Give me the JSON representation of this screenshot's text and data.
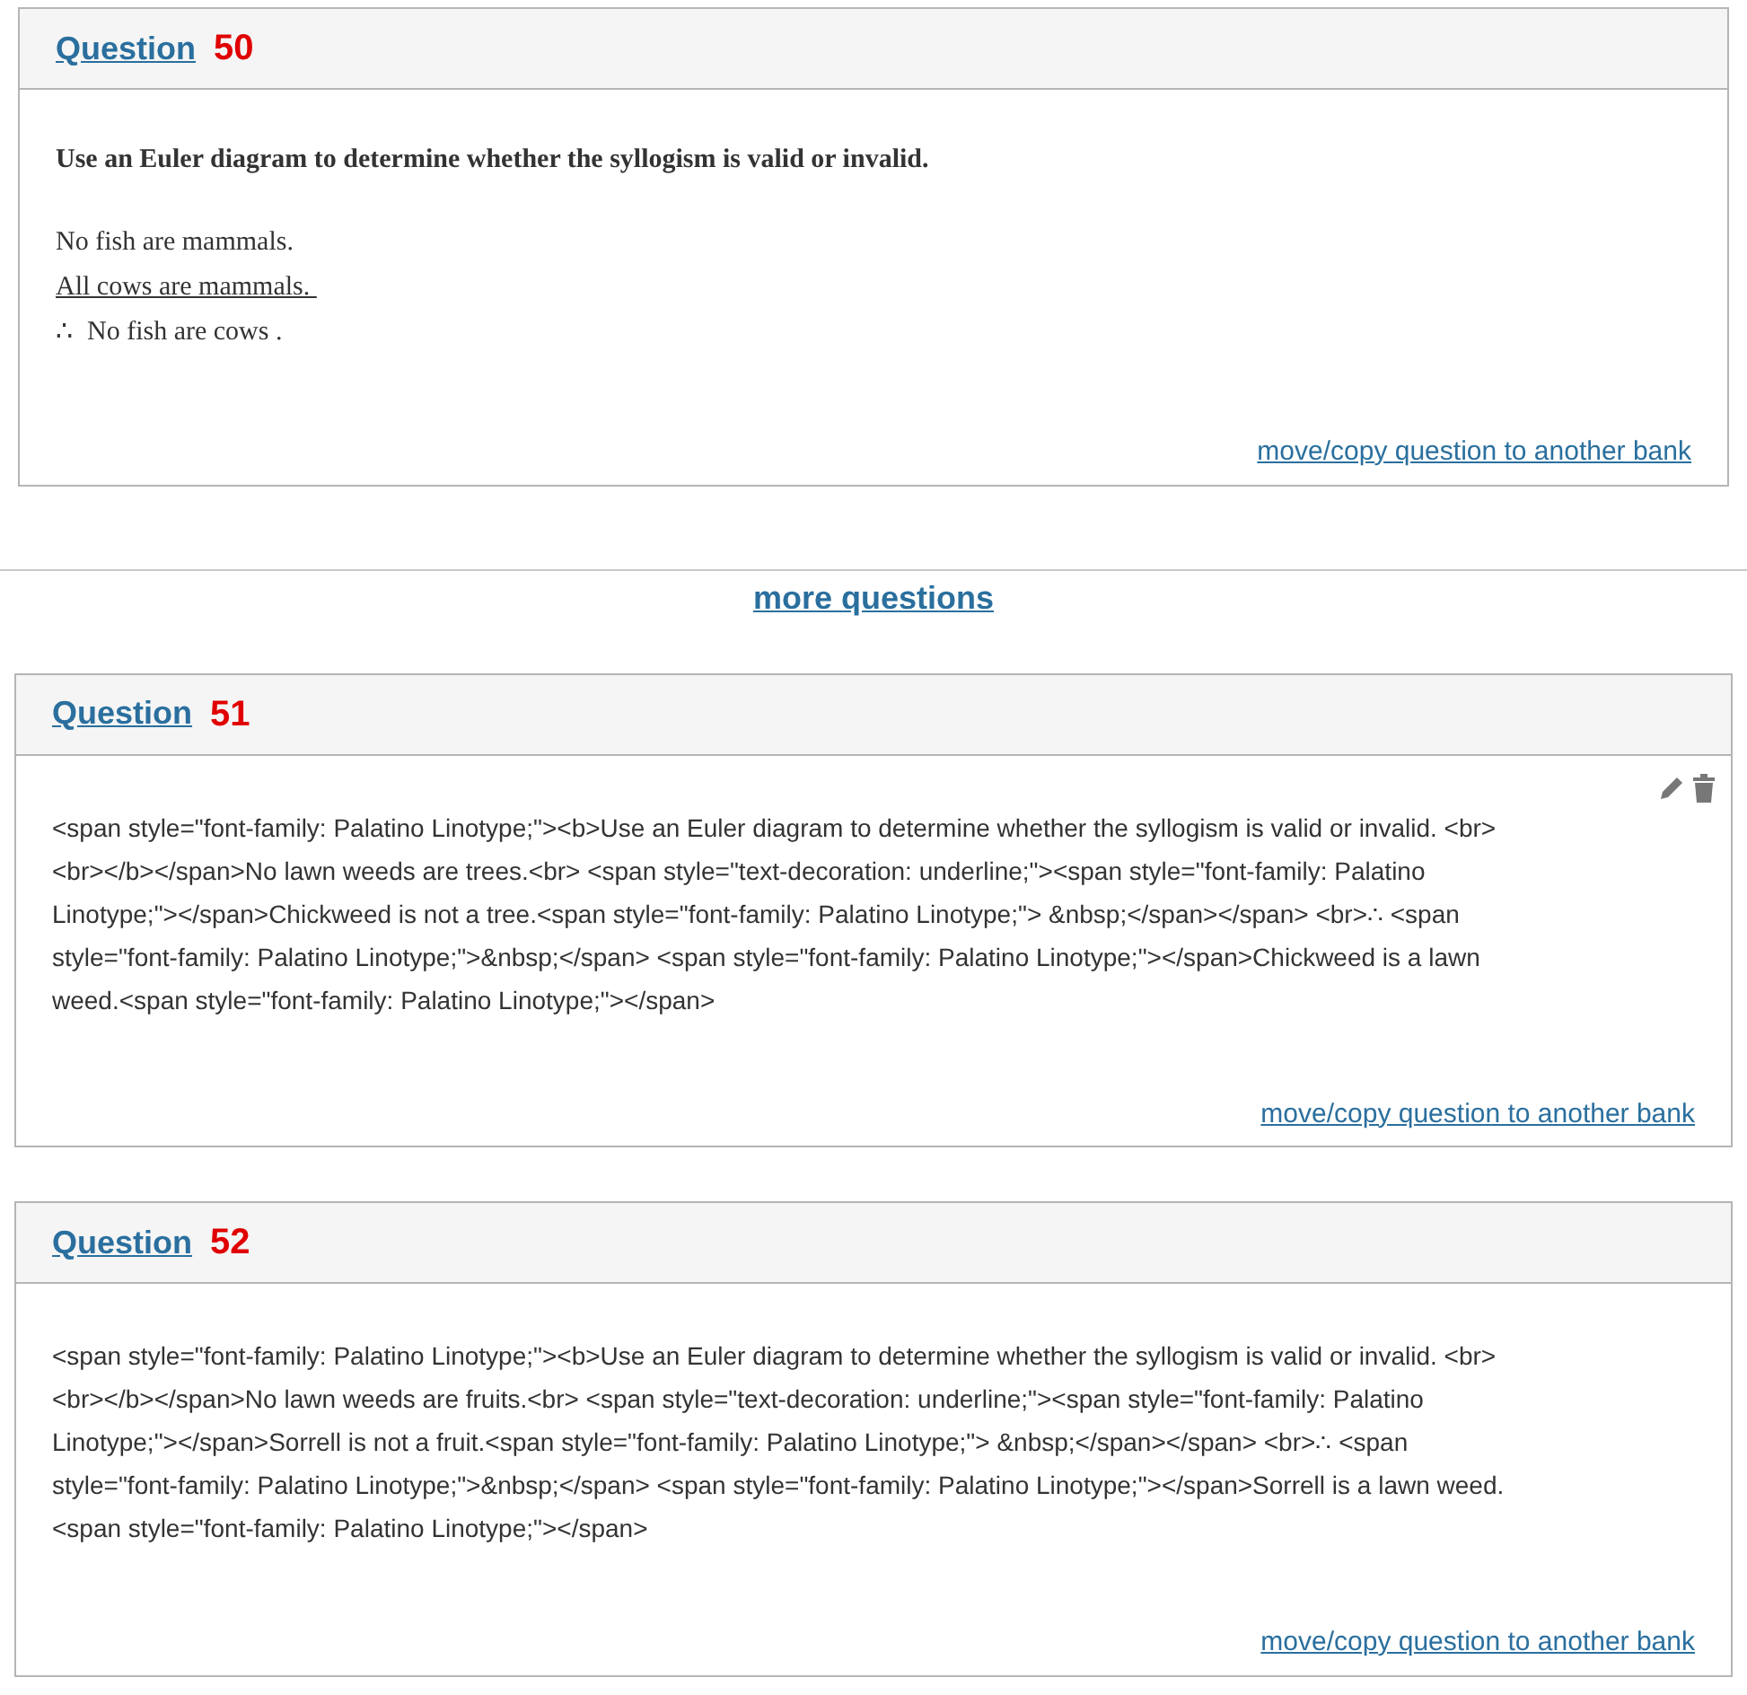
{
  "questions": [
    {
      "label": "Question",
      "number": "50",
      "kind": "formatted",
      "tools": false,
      "lines": [
        {
          "text": "Use an Euler diagram to determine whether the syllogism is valid or invalid.",
          "kind": "instruction"
        },
        {
          "text": "No fish are mammals.",
          "kind": "premise"
        },
        {
          "text": "All cows are mammals. ",
          "kind": "last_premise"
        },
        {
          "text": "∴  No fish are cows .",
          "kind": "conclusion"
        }
      ],
      "link": "move/copy question to another bank"
    },
    {
      "more_link": "more questions"
    },
    {
      "label": "Question",
      "number": "51",
      "kind": "raw",
      "tools": true,
      "text": "<span style=\"font-family: Palatino Linotype;\"><b>Use an Euler diagram to determine whether the syllogism is valid or invalid. <br><br></b></span>No lawn weeds are trees.<br> <span style=\"text-decoration: underline;\"><span style=\"font-family: Palatino Linotype;\"></span>Chickweed is not a tree.<span style=\"font-family: Palatino Linotype;\"> &nbsp;</span></span> <br>∴ <span style=\"font-family: Palatino Linotype;\">&nbsp;</span> <span style=\"font-family: Palatino Linotype;\"></span>Chickweed is a lawn weed.<span style=\"font-family: Palatino Linotype;\"></span>",
      "link": "move/copy question to another bank"
    },
    {
      "label": "Question",
      "number": "52",
      "kind": "raw",
      "tools": false,
      "text": "<span style=\"font-family: Palatino Linotype;\"><b>Use an Euler diagram to determine whether the syllogism is valid or invalid. <br><br></b></span>No lawn weeds are fruits.<br> <span style=\"text-decoration: underline;\"><span style=\"font-family: Palatino Linotype;\"></span>Sorrell is not a fruit.<span style=\"font-family: Palatino Linotype;\"> &nbsp;</span></span> <br>∴ <span style=\"font-family: Palatino Linotype;\">&nbsp;</span> <span style=\"font-family: Palatino Linotype;\"></span>Sorrell is a lawn weed.<span style=\"font-family: Palatino Linotype;\"></span>",
      "link": "move/copy question to another bank"
    }
  ]
}
